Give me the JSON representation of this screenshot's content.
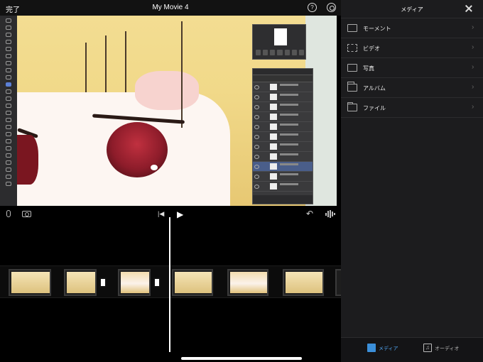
{
  "top_bar": {
    "done_label": "完了",
    "title": "My Movie 4",
    "help_label": "?"
  },
  "controls": {
    "skip_glyph": "|◀",
    "play_glyph": "▶",
    "undo_glyph": "↶"
  },
  "media_panel": {
    "title": "メディア",
    "items": [
      {
        "label": "モーメント",
        "icon": "moments-icon"
      },
      {
        "label": "ビデオ",
        "icon": "video-icon"
      },
      {
        "label": "写真",
        "icon": "photo-icon"
      },
      {
        "label": "アルバム",
        "icon": "album-icon"
      },
      {
        "label": "ファイル",
        "icon": "folder-icon"
      }
    ],
    "footer_tabs": [
      {
        "label": "メディア",
        "icon": "media-icon",
        "selected": true
      },
      {
        "label": "オーディオ",
        "icon": "audio-icon",
        "selected": false
      }
    ]
  },
  "colors": {
    "accent": "#4fa3ef",
    "panel_bg": "#1c1c1e"
  }
}
